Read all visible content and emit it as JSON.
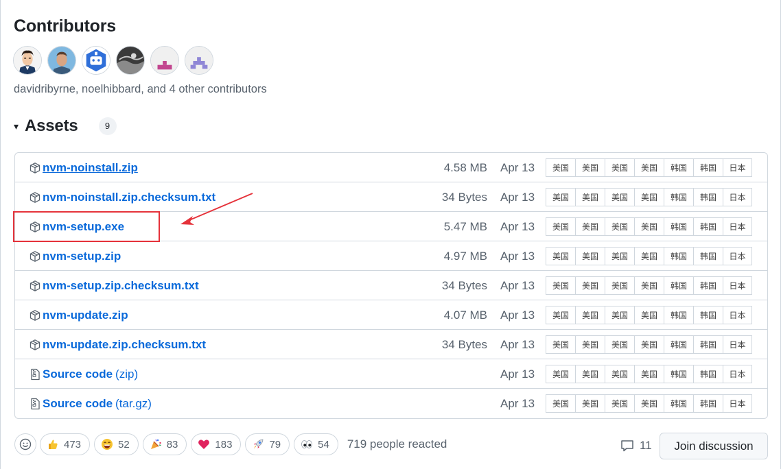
{
  "contributors": {
    "title": "Contributors",
    "avatars": [
      {
        "name": "contributor-avatar-1"
      },
      {
        "name": "contributor-avatar-2"
      },
      {
        "name": "contributor-avatar-3"
      },
      {
        "name": "contributor-avatar-4"
      },
      {
        "name": "contributor-avatar-5"
      },
      {
        "name": "contributor-avatar-6"
      }
    ],
    "summary": "davidribyrne, noelhibbard, and 4 other contributors"
  },
  "assets": {
    "caret": "▾",
    "title": "Assets",
    "count": "9",
    "mirror_labels": [
      "美国",
      "美国",
      "美国",
      "美国",
      "韩国",
      "韩国",
      "日本"
    ],
    "rows": [
      {
        "name": "nvm-noinstall.zip",
        "suffix": "",
        "size": "4.58 MB",
        "date": "Apr 13",
        "icon": "package-icon",
        "underline": true
      },
      {
        "name": "nvm-noinstall.zip.checksum.txt",
        "suffix": "",
        "size": "34 Bytes",
        "date": "Apr 13",
        "icon": "package-icon",
        "underline": false
      },
      {
        "name": "nvm-setup.exe",
        "suffix": "",
        "size": "5.47 MB",
        "date": "Apr 13",
        "icon": "package-icon",
        "underline": false
      },
      {
        "name": "nvm-setup.zip",
        "suffix": "",
        "size": "4.97 MB",
        "date": "Apr 13",
        "icon": "package-icon",
        "underline": false
      },
      {
        "name": "nvm-setup.zip.checksum.txt",
        "suffix": "",
        "size": "34 Bytes",
        "date": "Apr 13",
        "icon": "package-icon",
        "underline": false
      },
      {
        "name": "nvm-update.zip",
        "suffix": "",
        "size": "4.07 MB",
        "date": "Apr 13",
        "icon": "package-icon",
        "underline": false
      },
      {
        "name": "nvm-update.zip.checksum.txt",
        "suffix": "",
        "size": "34 Bytes",
        "date": "Apr 13",
        "icon": "package-icon",
        "underline": false
      },
      {
        "name": "Source code",
        "suffix": "(zip)",
        "size": "",
        "date": "Apr 13",
        "icon": "file-zip-icon",
        "underline": false
      },
      {
        "name": "Source code",
        "suffix": "(tar.gz)",
        "size": "",
        "date": "Apr 13",
        "icon": "file-zip-icon",
        "underline": false
      }
    ]
  },
  "reactions": {
    "items": [
      {
        "emoji": "thumbs-up-icon",
        "count": "473"
      },
      {
        "emoji": "laugh-icon",
        "count": "52"
      },
      {
        "emoji": "hooray-icon",
        "count": "83"
      },
      {
        "emoji": "heart-icon",
        "count": "183"
      },
      {
        "emoji": "rocket-icon",
        "count": "79"
      },
      {
        "emoji": "eyes-icon",
        "count": "54"
      }
    ],
    "summary": "719 people reacted"
  },
  "discussion": {
    "comment_count": "11",
    "join_label": "Join discussion"
  },
  "colors": {
    "link": "#0969da",
    "muted": "#59636e",
    "annotation": "#e5323a"
  }
}
